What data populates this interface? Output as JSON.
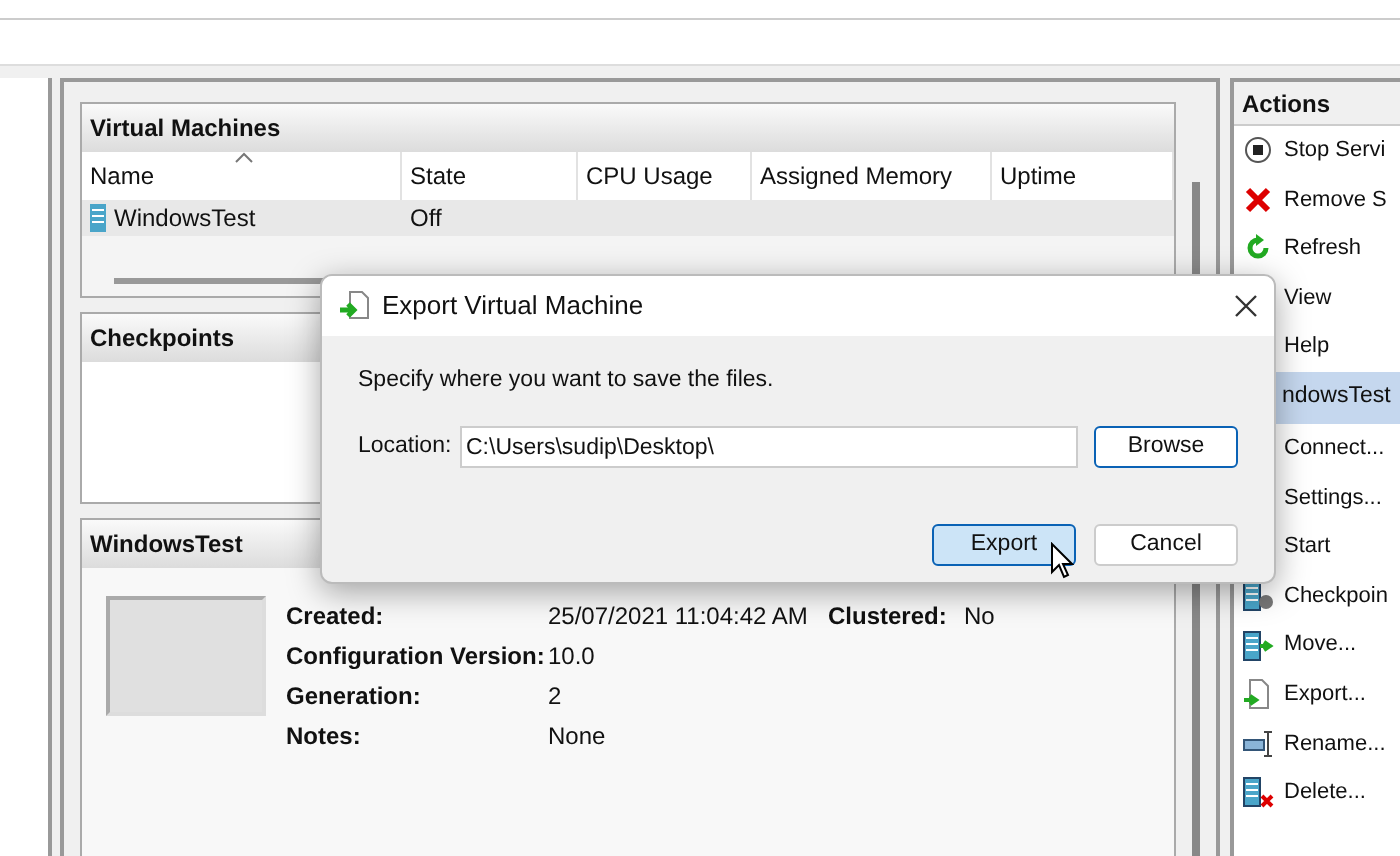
{
  "vm_panel": {
    "title": "Virtual Machines",
    "columns": [
      "Name",
      "State",
      "CPU Usage",
      "Assigned Memory",
      "Uptime"
    ],
    "rows": [
      {
        "name": "WindowsTest",
        "state": "Off",
        "selected": true
      }
    ]
  },
  "checkpoints": {
    "title": "Checkpoints"
  },
  "details": {
    "title": "WindowsTest",
    "fields": [
      {
        "label": "Created:",
        "value": "25/07/2021 11:04:42 AM"
      },
      {
        "label": "Configuration Version:",
        "value": "10.0"
      },
      {
        "label": "Generation:",
        "value": "2"
      },
      {
        "label": "Notes:",
        "value": "None"
      }
    ],
    "extra": {
      "label": "Clustered:",
      "value": "No"
    }
  },
  "actions": {
    "title": "Actions",
    "items": [
      {
        "label": "Stop Servi",
        "kind": "item"
      },
      {
        "label": "Remove S",
        "kind": "item"
      },
      {
        "label": "Refresh",
        "kind": "item"
      },
      {
        "label": "View",
        "kind": "item"
      },
      {
        "label": "Help",
        "kind": "item"
      },
      {
        "label": "ndowsTest",
        "kind": "header"
      },
      {
        "label": "Connect...",
        "kind": "item"
      },
      {
        "label": "Settings...",
        "kind": "item"
      },
      {
        "label": "Start",
        "kind": "item"
      },
      {
        "label": "Checkpoin",
        "kind": "item"
      },
      {
        "label": "Move...",
        "kind": "item"
      },
      {
        "label": "Export...",
        "kind": "item"
      },
      {
        "label": "Rename...",
        "kind": "item"
      },
      {
        "label": "Delete...",
        "kind": "item"
      }
    ]
  },
  "dialog": {
    "title": "Export Virtual Machine",
    "message": "Specify where you want to save the files.",
    "location_label": "Location:",
    "location_value": "C:\\Users\\sudip\\Desktop\\",
    "buttons": [
      {
        "label": "Browse",
        "focused": false
      },
      {
        "label": "Export",
        "focused": true
      },
      {
        "label": "Cancel",
        "focused": false
      }
    ]
  }
}
